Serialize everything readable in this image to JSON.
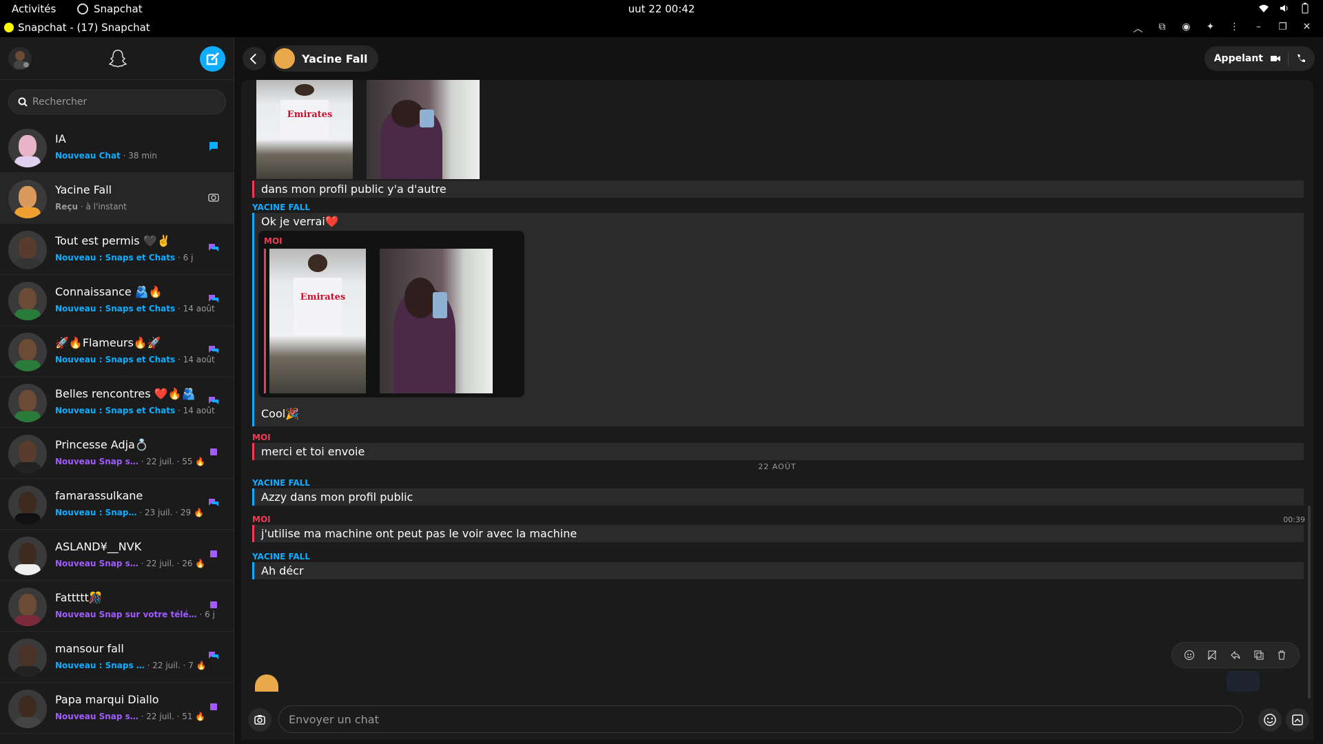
{
  "topbar": {
    "activities": "Activités",
    "app_name": "Snapchat",
    "clock": "uut 22  00:42"
  },
  "window": {
    "title": "Snapchat - (17) Snapchat"
  },
  "sidebar": {
    "search_placeholder": "Rechercher",
    "chats": [
      {
        "name": "IA",
        "status": "Nouveau Chat",
        "time": "· 38 min",
        "status_color": "#0fadff",
        "badge": "chat"
      },
      {
        "name": "Yacine Fall",
        "status": "Reçu",
        "time": "· à l'instant",
        "status_color": "#9a9a9a",
        "badge": "camera",
        "active": true
      },
      {
        "name": "Tout est permis 🖤✌️",
        "status": "Nouveau : Snaps et Chats",
        "time": "· 6 j",
        "status_color": "#0fadff",
        "badge": "multi"
      },
      {
        "name": "Connaissance 🫂🔥",
        "status": "Nouveau : Snaps et Chats",
        "time": "· 14 août",
        "status_color": "#0fadff",
        "badge": "multi"
      },
      {
        "name": "🚀🔥Flameurs🔥🚀",
        "status": "Nouveau : Snaps et Chats",
        "time": "· 14 août",
        "status_color": "#0fadff",
        "badge": "multi"
      },
      {
        "name": "Belles rencontres ❤️🔥🫂",
        "status": "Nouveau : Snaps et Chats",
        "time": "· 14 août",
        "status_color": "#0fadff",
        "badge": "multi"
      },
      {
        "name": "Princesse Adja💍",
        "status": "Nouveau Snap s…",
        "time": "· 22 juil. · 55 🔥",
        "status_color": "#a05cff",
        "badge": "snap"
      },
      {
        "name": "famarassulkane",
        "status": "Nouveau : Snap…",
        "time": "· 23 juil. · 29 🔥",
        "status_color": "#0fadff",
        "badge": "multi"
      },
      {
        "name": "ASLAND¥__NVK",
        "status": "Nouveau Snap s…",
        "time": "· 22 juil. · 26 🔥",
        "status_color": "#a05cff",
        "badge": "snap"
      },
      {
        "name": "Fattttt🎊",
        "status": "Nouveau Snap sur votre télé…",
        "time": "· 6 j",
        "status_color": "#a05cff",
        "badge": "snap"
      },
      {
        "name": "mansour fall",
        "status": "Nouveau : Snaps …",
        "time": "· 22 juil. · 7 🔥",
        "status_color": "#0fadff",
        "badge": "multi"
      },
      {
        "name": "Papa marqui Diallo",
        "status": "Nouveau Snap s…",
        "time": "· 22 juil. · 51 🔥",
        "status_color": "#a05cff",
        "badge": "snap"
      }
    ]
  },
  "conversation": {
    "contact_name": "Yacine Fall",
    "call_label": "Appelant",
    "messages": {
      "m1_text": "dans mon profil public y'a d'autre",
      "m2_sender": "YACINE FALL",
      "m2_text": "Ok je verrai❤️",
      "quote_sender": "MOI",
      "m2b_text": "Cool🎉",
      "m3_sender": "MOI",
      "m3_text": "merci et toi envoie",
      "day_separator": "22 AOÛT",
      "m4_sender": "YACINE FALL",
      "m4_text": "Azzy dans mon profil public",
      "m5_sender": "MOI",
      "m5_time": "00:39",
      "m5_text": "j'utilise ma machine ont peut pas le voir avec la machine",
      "m6_sender": "YACINE FALL",
      "m6_text": "Ah décr"
    },
    "photo_jersey_text": "Emirates",
    "composer_placeholder": "Envoyer un chat"
  },
  "colors": {
    "accent_blue": "#0fadff",
    "me_red": "#f23c57",
    "snap_purple": "#a05cff"
  }
}
